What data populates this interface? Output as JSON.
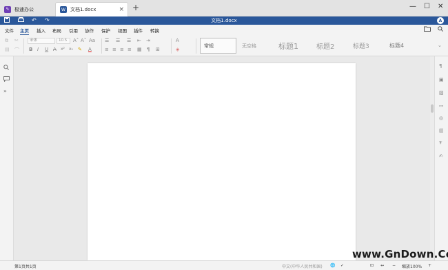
{
  "tabs": {
    "home": {
      "label": "极速办公",
      "icon": "app-logo-icon"
    },
    "document": {
      "label": "文档1.docx",
      "icon": "word-doc-icon",
      "close_glyph": "×"
    },
    "new_tab_glyph": "+"
  },
  "window_controls": {
    "minimize": "—",
    "maximize": "☐",
    "close": "✕"
  },
  "titlebar": {
    "title": "文档1.docx",
    "quick_access": {
      "save": "💾",
      "print": "⎙",
      "undo": "↶",
      "redo": "↷"
    },
    "avatar_letter": "A"
  },
  "menu": {
    "items": [
      "文件",
      "主页",
      "插入",
      "布局",
      "引用",
      "协作",
      "保护",
      "视图",
      "插件",
      "转换"
    ],
    "active": "主页",
    "folder_icon": "📂",
    "search_icon": "🔍"
  },
  "ribbon": {
    "font_name": "宋体",
    "font_size": "10.5",
    "grow_font": "A˄",
    "shrink_font": "A˅",
    "case_change": "Aa",
    "bold": "B",
    "italic": "I",
    "underline": "U",
    "strikethrough": "A",
    "superscript": "x²",
    "subscript": "x₂",
    "highlight": "✎",
    "font_color": "A",
    "styles": [
      "常规",
      "无空格",
      "标题1",
      "标题2",
      "标题3",
      "标题4"
    ],
    "selected_style": "常规"
  },
  "statusbar": {
    "page_info": "第1页共1页",
    "language": "中文(中华人民共和国)",
    "zoom_label": "缩放100%",
    "zoom_minus": "−",
    "zoom_plus": "+"
  },
  "watermark": "www.GnDown.Com"
}
